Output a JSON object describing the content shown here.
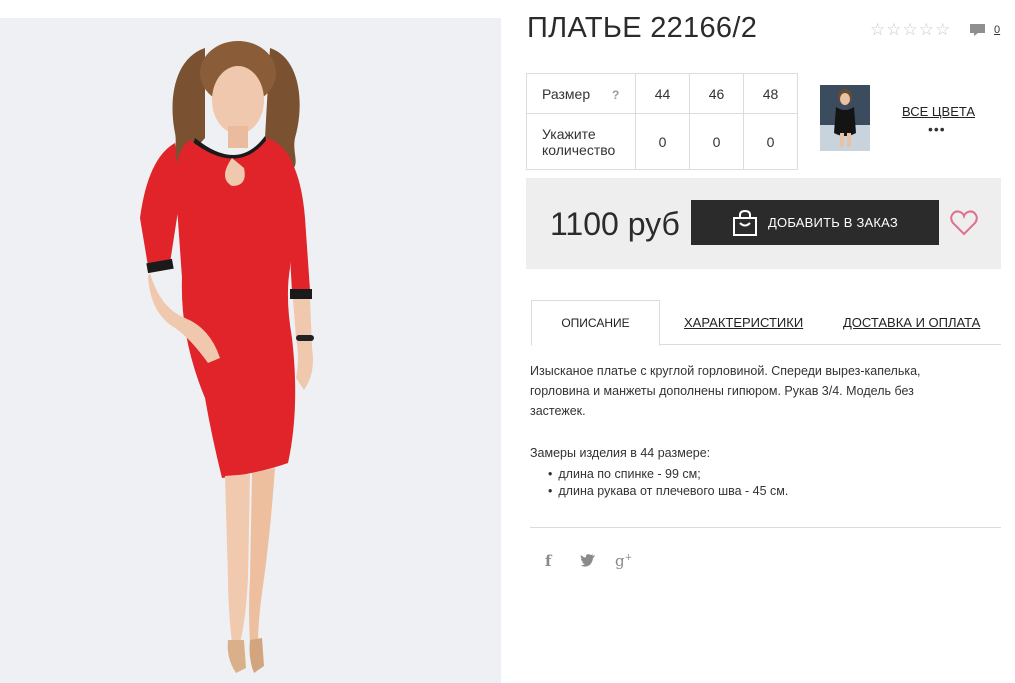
{
  "product": {
    "title": "ПЛАТЬЕ 22166/2",
    "rating_stars": 0,
    "rating_max": 5,
    "comment_count": "0"
  },
  "size_table": {
    "size_label": "Размер",
    "help_mark": "?",
    "sizes": [
      "44",
      "46",
      "48"
    ],
    "quantity_label": "Укажите количество",
    "quantities": [
      "0",
      "0",
      "0"
    ]
  },
  "colors": {
    "all_colors_label": "ВСЕ ЦВЕТА",
    "more": "•••"
  },
  "buy": {
    "price": "1100 руб",
    "add_button_label": "ДОБАВИТЬ В ЗАКАЗ",
    "button_bg": "#2b2b2b",
    "wish_color": "#e0708f"
  },
  "tabs": {
    "description": "ОПИСАНИЕ",
    "characteristics": "ХАРАКТЕРИСТИКИ",
    "delivery": "ДОСТАВКА И ОПЛАТА"
  },
  "description": {
    "text": "Изысканое платье с круглой горловиной. Спереди вырез-капелька, горловина и манжеты дополнены гипюром. Рукав 3/4. Модель без застежек.",
    "measures_title": "Замеры изделия в 44 размере:",
    "measures": [
      "длина по спинке - 99 см;",
      "длина рукава от плечевого шва - 45 см."
    ]
  },
  "social": {
    "facebook": "f",
    "googleplus": "g",
    "googleplus_sup": "+"
  },
  "colors_palette": {
    "dress": "#e0242a",
    "page_bg": "#ffffff",
    "photo_bg": "#eef0f3"
  }
}
